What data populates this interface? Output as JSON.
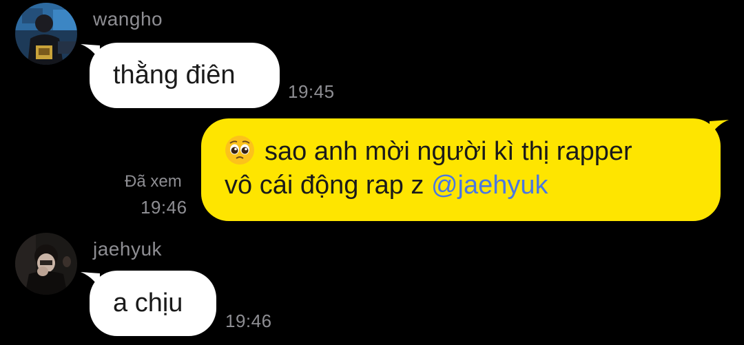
{
  "messages": [
    {
      "sender": "wangho",
      "avatar_icon": "gamer-avatar-icon",
      "text": "thằng điên",
      "time": "19:45"
    },
    {
      "sender": "me",
      "emoji_icon": "pleading-face-icon",
      "line1": "sao anh mời người kì thị rapper",
      "line2_text": "vô cái động rap z ",
      "mention": "@jaehyuk",
      "read_status": "Đã xem",
      "time": "19:46"
    },
    {
      "sender": "jaehyuk",
      "avatar_icon": "person-avatar-icon",
      "text": "a chịu",
      "time": "19:46"
    }
  ],
  "colors": {
    "background": "#000000",
    "incoming_bubble": "#ffffff",
    "outgoing_bubble": "#fee500",
    "mention": "#4a77e2",
    "meta_text": "#8e8e93"
  }
}
